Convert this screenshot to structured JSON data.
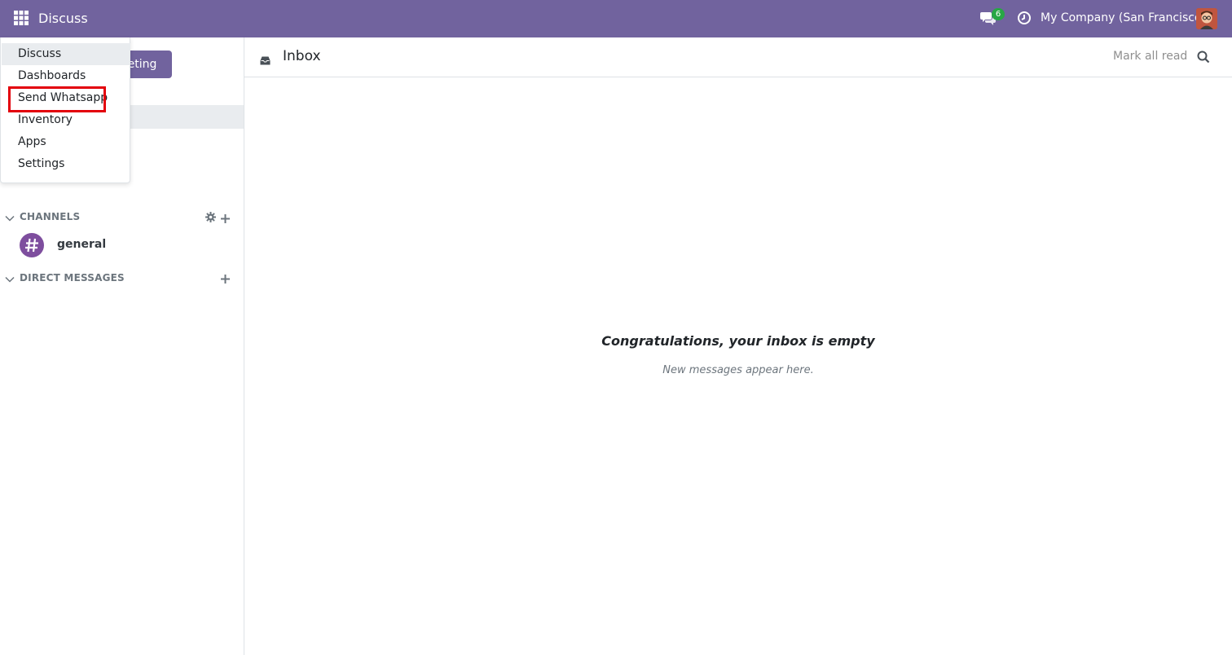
{
  "navbar": {
    "brand": "Discuss",
    "company": "My Company (San Francisco)",
    "message_count": "6",
    "background_color": "#71639e",
    "icons": {
      "apps": "apps-grid-icon",
      "messages": "chat-bubbles-icon",
      "activities": "clock-icon"
    }
  },
  "app_menu": {
    "items": [
      {
        "label": "Discuss"
      },
      {
        "label": "Dashboards"
      },
      {
        "label": "Send Whatsapp"
      },
      {
        "label": "Inventory"
      },
      {
        "label": "Apps"
      },
      {
        "label": "Settings"
      }
    ],
    "highlighted_item": "Send Whatsapp",
    "highlight_color": "#e3000b"
  },
  "sidebar": {
    "meeting_button": "eeting",
    "channels": {
      "header": "CHANNELS",
      "items": [
        {
          "name": "general",
          "icon": "hash-icon"
        }
      ]
    },
    "direct_messages": {
      "header": "DIRECT MESSAGES"
    }
  },
  "main": {
    "title": "Inbox",
    "mark_all_read": "Mark all read",
    "empty_title": "Congratulations, your inbox is empty",
    "empty_subtitle": "New messages appear here."
  }
}
